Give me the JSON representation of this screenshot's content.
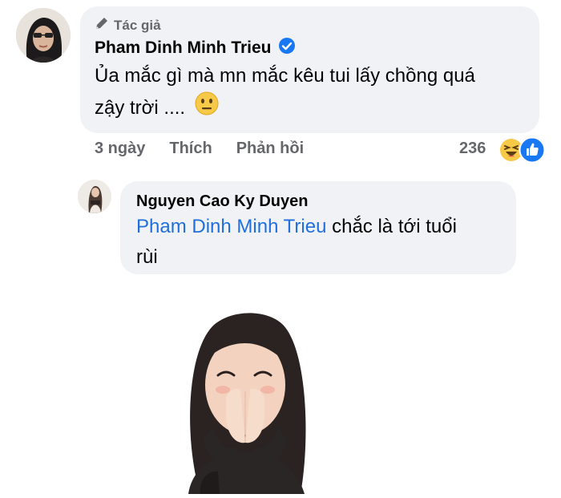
{
  "comment": {
    "author_badge": "Tác giả",
    "author_name": "Pham Dinh Minh Trieu",
    "text_line1": "Ủa mắc gì mà mn mắc kêu tui lấy chồng quá",
    "text_line2": "zậy trời ....",
    "time": "3 ngày",
    "like_label": "Thích",
    "reply_label": "Phản hồi",
    "reaction_count": "236"
  },
  "reply": {
    "author_name": "Nguyen Cao Ky Duyen",
    "mention": "Pham Dinh Minh Trieu",
    "text_after_mention": " chắc là tới tuổi",
    "text_line2": "rùi"
  },
  "icons": [
    "pen-icon",
    "verified-badge-icon",
    "neutral-face-emoji-icon",
    "haha-reaction-icon",
    "like-reaction-icon"
  ],
  "colors": {
    "bubble": "#f0f2f5",
    "mention": "#216fdb",
    "verified": "#1877f2",
    "muted": "#65676b"
  }
}
